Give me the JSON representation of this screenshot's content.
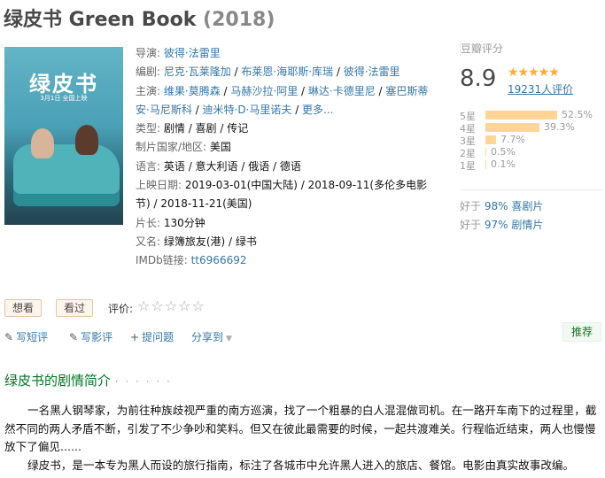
{
  "title": {
    "name": "绿皮书 Green Book",
    "year": "(2018)"
  },
  "poster": {
    "title": "绿皮书",
    "date_line": "3月1日 全国上映"
  },
  "info": {
    "director_label": "导演:",
    "director": "彼得·法雷里",
    "writer_label": "编剧:",
    "writers": [
      "尼克·瓦莱隆加",
      "布莱恩·海耶斯·库瑞",
      "彼得·法雷里"
    ],
    "cast_label": "主演:",
    "cast": [
      "维果·莫腾森",
      "马赫沙拉·阿里",
      "琳达·卡德里尼",
      "塞巴斯蒂安·马尼斯科",
      "迪米特·D·马里诺夫"
    ],
    "cast_more": "更多...",
    "genre_label": "类型:",
    "genres": "剧情 / 喜剧 / 传记",
    "country_label": "制片国家/地区:",
    "country": "美国",
    "language_label": "语言:",
    "languages": "英语 / 意大利语 / 俄语 / 德语",
    "release_label": "上映日期:",
    "release_line1": "2019-03-01(中国大陆) / 2018-09-11(多伦多电影",
    "release_line2": "节) / 2018-11-21(美国)",
    "runtime_label": "片长:",
    "runtime": "130分钟",
    "aka_label": "又名:",
    "aka": "绿簿旅友(港) / 绿书",
    "imdb_label": "IMDb链接:",
    "imdb": "tt6966692"
  },
  "rating": {
    "header": "豆瓣评分",
    "score": "8.9",
    "stars_display": "★★★★★",
    "votes": "19231人评价",
    "distribution": [
      {
        "label": "5星",
        "percent": 52.5,
        "text": "52.5%"
      },
      {
        "label": "4星",
        "percent": 39.3,
        "text": "39.3%"
      },
      {
        "label": "3星",
        "percent": 7.7,
        "text": "7.7%"
      },
      {
        "label": "2星",
        "percent": 0.5,
        "text": "0.5%"
      },
      {
        "label": "1星",
        "percent": 0.1,
        "text": "0.1%"
      }
    ],
    "better_than": [
      {
        "prefix": "好于",
        "link": "98% 喜剧片"
      },
      {
        "prefix": "好于",
        "link": "97% 剧情片"
      }
    ]
  },
  "actions": {
    "want": "想看",
    "seen": "看过",
    "rate_label": "评价:",
    "rate_stars": "☆☆☆☆☆",
    "write_short": "写短评",
    "write_review": "写影评",
    "ask": "提问题",
    "share": "分享到",
    "recommend": "推荐"
  },
  "summary": {
    "title": "绿皮书的剧情简介",
    "dots": "· · · · · ·",
    "para1": "一名黑人钢琴家，为前往种族歧视严重的南方巡演，找了一个粗暴的白人混混做司机。在一路开车南下的过程里，截然不同的两人矛盾不断，引发了不少争吵和笑料。但又在彼此最需要的时候，一起共渡难关。行程临近结束，两人也慢慢放下了偏见......",
    "para2": "绿皮书，是一本专为黑人而设的旅行指南，标注了各城市中允许黑人进入的旅店、餐馆。电影由真实故事改编。"
  },
  "colors": {
    "link": "#3377aa",
    "star": "#ffac2d",
    "bar": "#ffd596",
    "section": "#007722"
  }
}
